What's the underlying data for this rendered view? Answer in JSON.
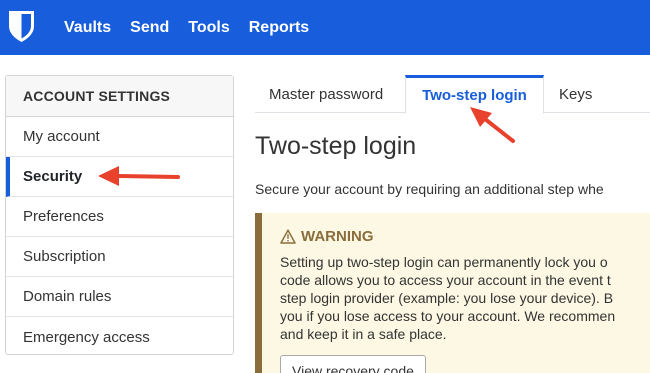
{
  "nav": {
    "logo_icon": "bitwarden-shield-icon",
    "items": [
      "Vaults",
      "Send",
      "Tools",
      "Reports"
    ]
  },
  "sidebar": {
    "header": "ACCOUNT SETTINGS",
    "items": [
      {
        "label": "My account"
      },
      {
        "label": "Security",
        "active": true
      },
      {
        "label": "Preferences"
      },
      {
        "label": "Subscription"
      },
      {
        "label": "Domain rules"
      },
      {
        "label": "Emergency access"
      }
    ]
  },
  "tabs": [
    {
      "label": "Master password"
    },
    {
      "label": "Two-step login",
      "active": true
    },
    {
      "label": "Keys"
    }
  ],
  "main": {
    "title": "Two-step login",
    "description": "Secure your account by requiring an additional step whe",
    "warning": {
      "icon": "warning-triangle-icon",
      "title": "WARNING",
      "lines": [
        "Setting up two-step login can permanently lock you o",
        "code allows you to access your account in the event t",
        "step login provider (example: you lose your device). B",
        "you if you lose access to your account. We recommen",
        "and keep it in a safe place."
      ],
      "button_label": "View recovery code"
    }
  },
  "colors": {
    "brand": "#175ddc",
    "warning_border": "#8a6d3b",
    "warning_bg": "#fcf8e3",
    "annotation_arrow": "#e8412c"
  }
}
